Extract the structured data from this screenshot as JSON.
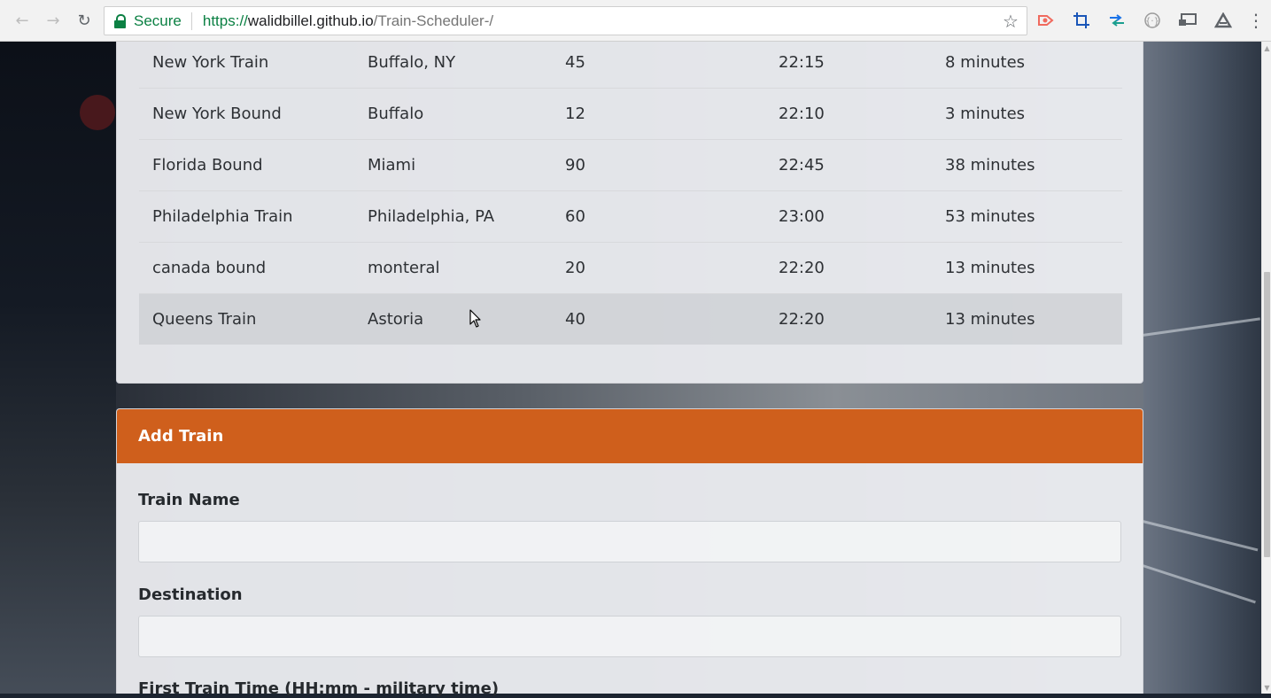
{
  "browser": {
    "security_label": "Secure",
    "url_scheme": "https://",
    "url_host": "walidbillel.github.io",
    "url_path": "/Train-Scheduler-/",
    "extensions": [
      "red-record-icon",
      "crop-icon",
      "arrows-swap-icon",
      "circle-code-icon",
      "cast-screen-icon",
      "drive-triangle-icon"
    ]
  },
  "schedule": {
    "rows": [
      {
        "name": "New York Train",
        "destination": "Buffalo, NY",
        "frequency": "45",
        "next_arrival": "22:15",
        "minutes_away": "8 minutes"
      },
      {
        "name": "New York Bound",
        "destination": "Buffalo",
        "frequency": "12",
        "next_arrival": "22:10",
        "minutes_away": "3 minutes"
      },
      {
        "name": "Florida Bound",
        "destination": "Miami",
        "frequency": "90",
        "next_arrival": "22:45",
        "minutes_away": "38 minutes"
      },
      {
        "name": "Philadelphia Train",
        "destination": "Philadelphia, PA",
        "frequency": "60",
        "next_arrival": "23:00",
        "minutes_away": "53 minutes"
      },
      {
        "name": "canada bound",
        "destination": "monteral",
        "frequency": "20",
        "next_arrival": "22:20",
        "minutes_away": "13 minutes"
      },
      {
        "name": "Queens Train",
        "destination": "Astoria",
        "frequency": "40",
        "next_arrival": "22:20",
        "minutes_away": "13 minutes"
      }
    ]
  },
  "add_train": {
    "title": "Add Train",
    "train_name_label": "Train Name",
    "train_name_value": "",
    "destination_label": "Destination",
    "destination_value": "",
    "first_time_label": "First Train Time (HH:mm - military time)"
  },
  "colors": {
    "header_accent": "#cf5f1c",
    "secure_green": "#0b8043"
  }
}
